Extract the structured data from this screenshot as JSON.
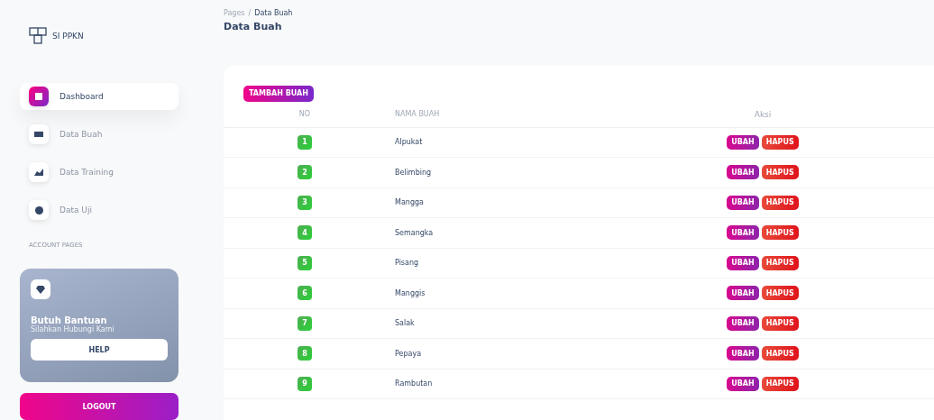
{
  "brand": {
    "name": "SI PPKN"
  },
  "sidebar": {
    "items": [
      {
        "label": "Dashboard",
        "selected": true
      },
      {
        "label": "Data Buah",
        "selected": false
      },
      {
        "label": "Data Training",
        "selected": false
      },
      {
        "label": "Data Uji",
        "selected": false
      }
    ],
    "section_title": "ACCOUNT PAGES",
    "help_card": {
      "title": "Butuh Bantuan",
      "subtitle": "Silahkan Hubungi Kami",
      "button": "HELP"
    },
    "logout": "LOGOUT"
  },
  "header": {
    "breadcrumb": [
      "Pages",
      "/",
      "Data Buah"
    ],
    "title": "Data Buah"
  },
  "add_button": "TAMBAH BUAH",
  "table": {
    "columns": [
      "NO",
      "NAMA BUAH",
      "Aksi"
    ],
    "rows": [
      {
        "no": "1",
        "name": "Alpukat",
        "actions": [
          "UBAH",
          "HAPUS"
        ]
      },
      {
        "no": "2",
        "name": "Belimbing",
        "actions": [
          "UBAH",
          "HAPUS"
        ]
      },
      {
        "no": "3",
        "name": "Mangga",
        "actions": [
          "UBAH",
          "HAPUS"
        ]
      },
      {
        "no": "4",
        "name": "Semangka",
        "actions": [
          "UBAH",
          "HAPUS"
        ]
      },
      {
        "no": "5",
        "name": "Pisang",
        "actions": [
          "UBAH",
          "HAPUS"
        ]
      },
      {
        "no": "6",
        "name": "Manggis",
        "actions": [
          "UBAH",
          "HAPUS"
        ]
      },
      {
        "no": "7",
        "name": "Salak",
        "actions": [
          "UBAH",
          "HAPUS"
        ]
      },
      {
        "no": "8",
        "name": "Pepaya",
        "actions": [
          "UBAH",
          "HAPUS"
        ]
      },
      {
        "no": "9",
        "name": "Rambutan",
        "actions": [
          "UBAH",
          "HAPUS"
        ]
      }
    ]
  }
}
